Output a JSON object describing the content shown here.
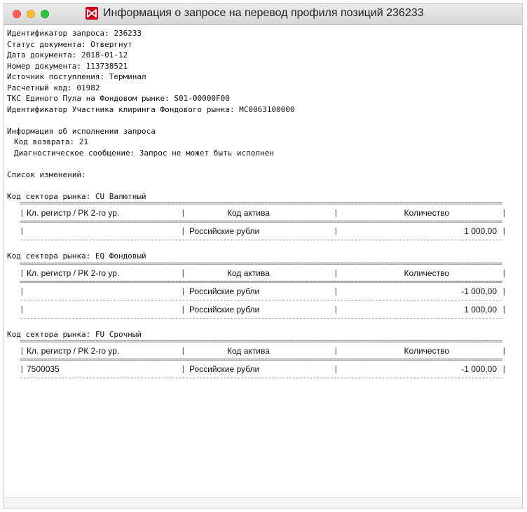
{
  "window": {
    "title": "Информация о запросе на перевод профиля позиций 236233"
  },
  "info": {
    "lines": [
      "Идентификатор запроса: 236233",
      "Статус документа: Отвергнут",
      "Дата документа: 2018-01-12",
      "Номер документа: 113738521",
      "Источник поступления: Терминал",
      "Расчетный код: 01982",
      "ТКС Единого Пула на Фондовом рынке: S01-00000F00",
      "Идентификатор Участника клиринга Фондового рынка: MC0063100000"
    ],
    "execution_header": "Информация об исполнении запроса",
    "return_code": "Код возврата: 21",
    "diagnostic": "Диагностическое сообщение: Запрос не может быть исполнен",
    "changes_header": "Список изменений:"
  },
  "table_headers": {
    "col1": "Кл. регистр / РК 2-го ур.",
    "col2": "Код актива",
    "col3": "Количество"
  },
  "sectors": [
    {
      "title": "Код сектора рынка: CU Валютный",
      "rows": [
        {
          "register": "",
          "asset": "Российские рубли",
          "quantity": "1 000,00"
        }
      ]
    },
    {
      "title": "Код сектора рынка: EQ Фондовый",
      "rows": [
        {
          "register": "",
          "asset": "Российские рубли",
          "quantity": "-1 000,00"
        },
        {
          "register": "",
          "asset": "Российские рубли",
          "quantity": "1 000,00"
        }
      ]
    },
    {
      "title": "Код сектора рынка: FU Срочный",
      "rows": [
        {
          "register": "7500035",
          "asset": "Российские рубли",
          "quantity": "-1 000,00"
        }
      ]
    }
  ]
}
